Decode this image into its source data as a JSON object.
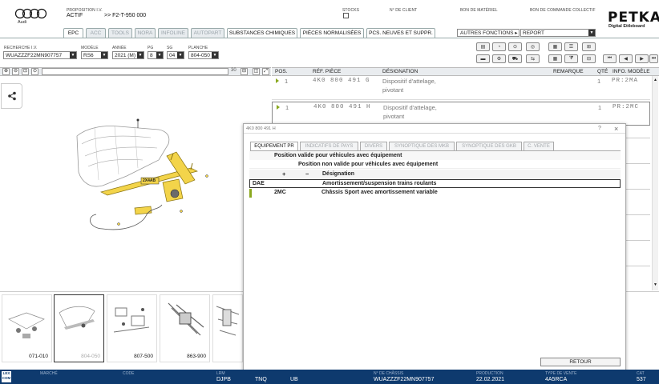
{
  "header": {
    "brand": "Audi",
    "proposition_label": "PROPOSITION I.V.",
    "proposition_status": "ACTIF",
    "proposition_ref": ">> F2-T-950 000",
    "stocks_label": "STOCKS",
    "client_label": "N° DE CLIENT",
    "materiel_label": "BON DE MATÉRIEL",
    "commande_label": "BON DE COMMANDE COLLECTIF",
    "petka_logo": "PETKA",
    "petka_sub": "Digital Ettleboard"
  },
  "tabs": [
    {
      "label": "EPC",
      "state": "active"
    },
    {
      "label": "ACC",
      "state": "disabled"
    },
    {
      "label": "TOOLS",
      "state": "disabled"
    },
    {
      "label": "NORA",
      "state": "disabled"
    },
    {
      "label": "INFOLINE",
      "state": "disabled"
    },
    {
      "label": "AUTOPART",
      "state": "disabled"
    },
    {
      "label": "SUBSTANCES CHIMIQUES",
      "state": "enabled"
    },
    {
      "label": "PIÈCES NORMALISÉES",
      "state": "enabled"
    },
    {
      "label": "PCS. NEUVES ET SUPPR.",
      "state": "enabled"
    }
  ],
  "autres_fonctions": {
    "label": "AUTRES FONCTIONS ▸",
    "value": "REPORT"
  },
  "vehicle": {
    "recherche_label": "RECHERCHE I.V.",
    "recherche_value": "WUAZZZF22MN907757",
    "modele_label": "MODÈLE",
    "modele_value": "RS6",
    "annee_label": "ANNÉE",
    "annee_value": "2021 (M)",
    "pg_label": "PG",
    "pg_value": "8",
    "sg_label": "SG",
    "sg_value": "04",
    "planche_label": "PLANCHE",
    "planche_value": "804-050"
  },
  "viewer": {
    "zoom": "30"
  },
  "parts_table": {
    "columns": [
      "POS.",
      "RÉF. PIÈCE",
      "DÉSIGNATION",
      "REMARQUE",
      "QTÉ",
      "INFO. MODÈLE"
    ],
    "rows": [
      {
        "pos": "1",
        "ref": "4K0 800 491 G",
        "desig_1": "Dispositif d'attelage,",
        "desig_2": "pivotant",
        "remarque": "",
        "qty": "1",
        "info": "PR:2MA"
      },
      {
        "pos": "1",
        "ref": "4K0 800 491 H",
        "desig_1": "Dispositif d'attelage,",
        "desig_2": "pivotant",
        "remarque": "",
        "qty": "1",
        "info": "PR:2MC"
      }
    ]
  },
  "diagram_callout": "2X4AB",
  "thumbnails": [
    {
      "label": "071-010",
      "selected": false
    },
    {
      "label": "804-050",
      "selected": true
    },
    {
      "label": "807-500",
      "selected": false
    },
    {
      "label": "863-900",
      "selected": false
    },
    {
      "label": "",
      "selected": false
    }
  ],
  "dialog": {
    "title": "4K0 800 491 H",
    "help": "?",
    "close": "×",
    "tabs": [
      {
        "label": "EQUIPEMENT PR",
        "active": true
      },
      {
        "label": "INDICATIFS DE PAYS",
        "active": false
      },
      {
        "label": "DIVERS",
        "active": false
      },
      {
        "label": "SYNOPTIQUE DES MKB",
        "active": false
      },
      {
        "label": "SYNOPTIQUE DES GKB",
        "active": false
      },
      {
        "label": "C. VENTE",
        "active": false
      }
    ],
    "valid_label": "Position valide pour véhicules avec équipement",
    "invalid_label": "Position non valide pour véhicules avec équipement",
    "col_plus": "+",
    "col_minus": "−",
    "col_desig": "Désignation",
    "rows": [
      {
        "code": "DAE",
        "desig": "Amortissement/suspension trains roulants"
      },
      {
        "code": "2MC",
        "desig": "Châssis Sport avec amortissement variable"
      }
    ],
    "retour": "RETOUR"
  },
  "footer": {
    "marche_label": "MARCHÉ",
    "marche_value": "",
    "code_label": "CODE",
    "code_value": "",
    "lrm_label": "LRM",
    "lrm_value": "DJPB",
    "b2_label": "",
    "b2_value": "TNQ",
    "b3_label": "",
    "b3_value": "UB",
    "vin_label": "N° DE CHÂSSIS",
    "vin_value": "WUAZZZF22MN907757",
    "prod_label": "PRODUCTION",
    "prod_value": "22.02.2021",
    "type_label": "TYPE DE VENTE",
    "type_value": "4A5RCA",
    "cat_label": "CAT",
    "cat_value": "537"
  },
  "colors": {
    "footer": "#0e3a6e",
    "accent_green": "#8aa81e",
    "highlight_yellow": "#e8c83c"
  }
}
